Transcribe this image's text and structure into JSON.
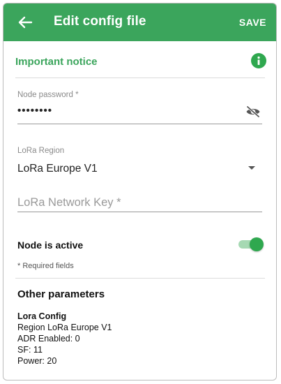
{
  "app_bar": {
    "title": "Edit config file",
    "save_label": "SAVE"
  },
  "notice": {
    "title": "Important notice"
  },
  "form": {
    "password": {
      "label": "Node password *",
      "value": "••••••••"
    },
    "region": {
      "label": "LoRa Region",
      "value": "LoRa Europe V1"
    },
    "network_key": {
      "placeholder": "LoRa Network Key *",
      "value": ""
    },
    "active": {
      "label": "Node is active",
      "enabled": true
    },
    "required_note": "* Required fields"
  },
  "other_parameters": {
    "title": "Other parameters",
    "heading": "Lora Config",
    "lines": [
      "Region LoRa Europe V1",
      "ADR Enabled: 0",
      "SF: 11",
      "Power: 20"
    ]
  },
  "icons": {
    "back": "arrow-left-icon",
    "info": "info-icon",
    "visibility": "eye-off-icon",
    "dropdown": "chevron-down-icon"
  },
  "colors": {
    "brand": "#3ba55c",
    "accent": "#2fa84f",
    "on_brand": "#ffffff"
  }
}
